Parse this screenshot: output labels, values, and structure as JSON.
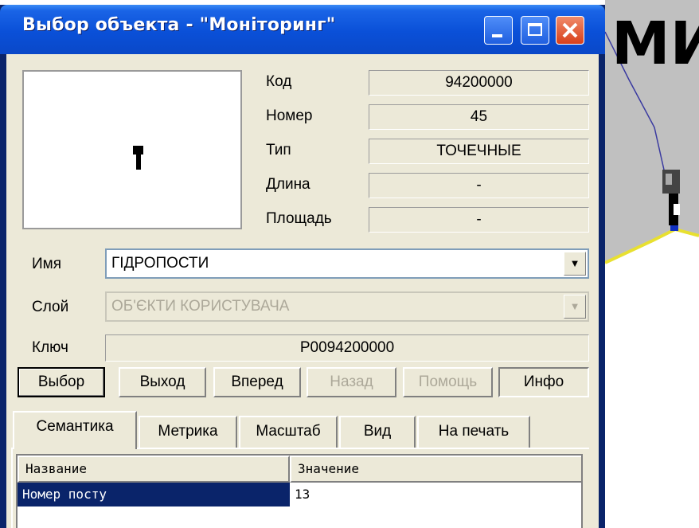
{
  "window": {
    "title": "Выбор объекта - \"Моніторинг\""
  },
  "background_map": {
    "text": "МИ"
  },
  "properties": {
    "code_label": "Код",
    "code_value": "94200000",
    "number_label": "Номер",
    "number_value": "45",
    "type_label": "Тип",
    "type_value": "ТОЧЕЧНЫЕ",
    "length_label": "Длина",
    "length_value": "-",
    "area_label": "Площадь",
    "area_value": "-"
  },
  "name": {
    "label": "Имя",
    "value": "ГІДРОПОСТИ"
  },
  "layer": {
    "label": "Слой",
    "value": "ОБ'ЄКТИ КОРИСТУВАЧА"
  },
  "key": {
    "label": "Ключ",
    "value": "Р0094200000"
  },
  "buttons": {
    "select": "Выбор",
    "exit": "Выход",
    "forward": "Вперед",
    "back": "Назад",
    "help": "Помощь",
    "info": "Инфо"
  },
  "tabs": [
    "Семантика",
    "Метрика",
    "Масштаб",
    "Вид",
    "На печать"
  ],
  "semantics_table": {
    "columns": [
      "Название",
      "Значение"
    ],
    "rows": [
      {
        "name": "Номер посту",
        "value": "13"
      }
    ]
  },
  "colors": {
    "title_bar": "#0a50d8",
    "window_face": "#ece9d8",
    "selection": "#0a246a",
    "map_fill": "#c0c0c0",
    "map_boundary": "#e8e030"
  }
}
